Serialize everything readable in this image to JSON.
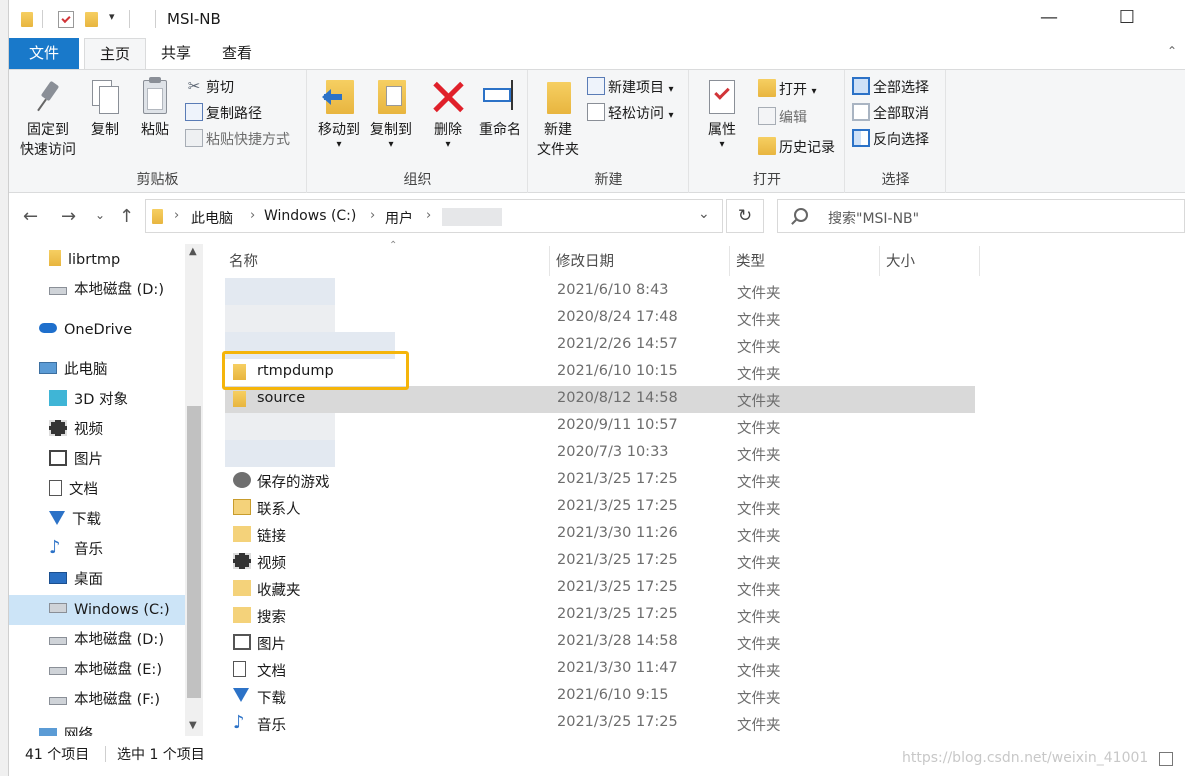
{
  "window": {
    "title": "MSI-NB",
    "controls": {
      "minimize": "—",
      "maximize": "☐",
      "close": "✕"
    }
  },
  "tabs": {
    "file": "文件",
    "home": "主页",
    "share": "共享",
    "view": "查看"
  },
  "ribbon": {
    "clipboard": {
      "label": "剪贴板",
      "pin_line1": "固定到",
      "pin_line2": "快速访问",
      "copy": "复制",
      "paste": "粘贴",
      "cut": "剪切",
      "copy_path": "复制路径",
      "paste_shortcut": "粘贴快捷方式"
    },
    "organize": {
      "label": "组织",
      "move_to": "移动到",
      "copy_to": "复制到",
      "delete": "删除",
      "rename": "重命名"
    },
    "new": {
      "label": "新建",
      "new_folder_line1": "新建",
      "new_folder_line2": "文件夹",
      "new_item": "新建项目",
      "easy_access": "轻松访问"
    },
    "open": {
      "label": "打开",
      "properties": "属性",
      "open": "打开",
      "edit": "编辑",
      "history": "历史记录"
    },
    "select": {
      "label": "选择",
      "select_all": "全部选择",
      "select_none": "全部取消",
      "invert": "反向选择"
    }
  },
  "address": {
    "crumbs": [
      "此电脑",
      "Windows (C:)",
      "用户"
    ],
    "search_placeholder": "搜索\"MSI-NB\""
  },
  "nav": [
    {
      "label": "librtmp",
      "icon": "folder-icon"
    },
    {
      "label": "本地磁盘 (D:)",
      "icon": "drive-icon"
    },
    {
      "label": "OneDrive",
      "icon": "cloud-icon"
    },
    {
      "label": "此电脑",
      "icon": "computer-icon"
    },
    {
      "label": "3D 对象",
      "icon": "cube-icon"
    },
    {
      "label": "视频",
      "icon": "video-icon"
    },
    {
      "label": "图片",
      "icon": "picture-icon"
    },
    {
      "label": "文档",
      "icon": "document-icon"
    },
    {
      "label": "下载",
      "icon": "download-icon"
    },
    {
      "label": "音乐",
      "icon": "music-icon"
    },
    {
      "label": "桌面",
      "icon": "desktop-icon"
    },
    {
      "label": "Windows (C:)",
      "icon": "windows-drive-icon"
    },
    {
      "label": "本地磁盘 (D:)",
      "icon": "drive-icon"
    },
    {
      "label": "本地磁盘 (E:)",
      "icon": "drive-icon"
    },
    {
      "label": "本地磁盘 (F:)",
      "icon": "drive-icon"
    },
    {
      "label": "网络",
      "icon": "network-icon"
    }
  ],
  "columns": {
    "name": "名称",
    "date": "修改日期",
    "type": "类型",
    "size": "大小"
  },
  "files": [
    {
      "name": "",
      "date": "2021/6/10 8:43",
      "type": "文件夹"
    },
    {
      "name": "",
      "date": "2020/8/24 17:48",
      "type": "文件夹"
    },
    {
      "name": "",
      "date": "2021/2/26 14:57",
      "type": "文件夹"
    },
    {
      "name": "rtmpdump",
      "date": "2021/6/10 10:15",
      "type": "文件夹"
    },
    {
      "name": "source",
      "date": "2020/8/12 14:58",
      "type": "文件夹"
    },
    {
      "name": "",
      "date": "2020/9/11 10:57",
      "type": "文件夹"
    },
    {
      "name": "",
      "date": "2020/7/3 10:33",
      "type": "文件夹"
    },
    {
      "name": "保存的游戏",
      "date": "2021/3/25 17:25",
      "type": "文件夹"
    },
    {
      "name": "联系人",
      "date": "2021/3/25 17:25",
      "type": "文件夹"
    },
    {
      "name": "链接",
      "date": "2021/3/30 11:26",
      "type": "文件夹"
    },
    {
      "name": "视频",
      "date": "2021/3/25 17:25",
      "type": "文件夹"
    },
    {
      "name": "收藏夹",
      "date": "2021/3/25 17:25",
      "type": "文件夹"
    },
    {
      "name": "搜索",
      "date": "2021/3/25 17:25",
      "type": "文件夹"
    },
    {
      "name": "图片",
      "date": "2021/3/28 14:58",
      "type": "文件夹"
    },
    {
      "name": "文档",
      "date": "2021/3/30 11:47",
      "type": "文件夹"
    },
    {
      "name": "下载",
      "date": "2021/6/10 9:15",
      "type": "文件夹"
    },
    {
      "name": "音乐",
      "date": "2021/3/25 17:25",
      "type": "文件夹"
    }
  ],
  "status": {
    "count": "41 个项目",
    "selected": "选中 1 个项目"
  },
  "watermark": "https://blog.csdn.net/weixin_41001"
}
